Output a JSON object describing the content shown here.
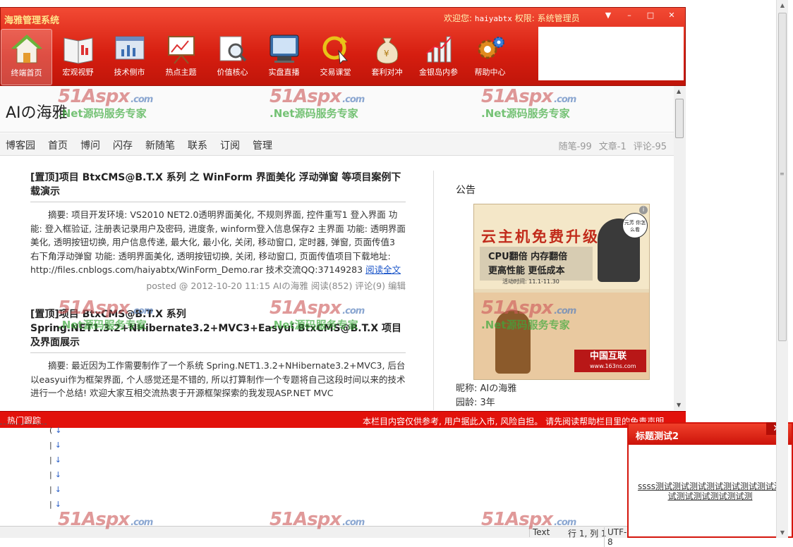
{
  "app": {
    "title": "海雅管理系统",
    "welcome_label": "欢迎您:",
    "username": "haiyabtx",
    "role_label": "权限:",
    "role": "系统管理员",
    "window_buttons": [
      "▼",
      "–",
      "□",
      "✕"
    ]
  },
  "nav": [
    {
      "label": "终端首页",
      "icon": "home-icon",
      "active": true
    },
    {
      "label": "宏观视野",
      "icon": "book-icon"
    },
    {
      "label": "技术侧市",
      "icon": "chart-window-icon"
    },
    {
      "label": "热点主题",
      "icon": "presentation-board-icon"
    },
    {
      "label": "价值核心",
      "icon": "magnifier-icon"
    },
    {
      "label": "实盘直播",
      "icon": "monitor-icon"
    },
    {
      "label": "交易课堂",
      "icon": "refresh-cursor-icon"
    },
    {
      "label": "套利对冲",
      "icon": "money-bag-icon"
    },
    {
      "label": "金银岛内参",
      "icon": "bar-chart-icon"
    },
    {
      "label": "帮助中心",
      "icon": "gear-icon"
    }
  ],
  "blog": {
    "title": "AIの海雅",
    "nav_links": [
      "博客园",
      "首页",
      "博问",
      "闪存",
      "新随笔",
      "联系",
      "订阅",
      "管理"
    ],
    "stats": [
      "随笔-99",
      "文章-1",
      "评论-95"
    ]
  },
  "posts": [
    {
      "title": "[置顶]项目 BtxCMS@B.T.X 系列 之 WinForm 界面美化 浮动弹窗 等项目案例下载演示",
      "summary": "摘要: 项目开发环境: VS2010 NET2.0透明界面美化, 不规则界面, 控件重写1 登入界面 功能: 登入框验证, 注册表记录用户及密码, 进度条, winform登入信息保存2 主界面 功能: 透明界面美化, 透明按钮切换, 用户信息传递, 最大化, 最小化, 关闭, 移动窗口, 定时器, 弹窗, 页面传值3 右下角浮动弹窗 功能: 透明界面美化, 透明按钮切换, 关闭, 移动窗口, 页面传值项目下载地址: http://files.cnblogs.com/haiyabtx/WinForm_Demo.rar 技术交流QQ:37149283",
      "read_more": "阅读全文",
      "meta": "posted @ 2012-10-20 11:15 AIの海雅 阅读(852) 评论(9) 编辑"
    },
    {
      "title": "[置顶]项目 BtxCMS@B.T.X 系列 Spring.NET1.3.2+NHibernate3.2+MVC3+Easyui BtxCMS@B.T.X 项目及界面展示",
      "summary": "摘要: 最近因为工作需要制作了一个系统 Spring.NET1.3.2+NHibernate3.2+MVC3, 后台以easyui作为框架界面, 个人感觉还是不错的, 所以打算制作一个专题将自己这段时间以来的技术进行一个总结! 欢迎大家互相交流热衷于开源框架探索的我发现ASP.NET MVC"
    }
  ],
  "sidebar": {
    "heading": "公告",
    "ad": {
      "headline": "云主机免费升级",
      "lines": [
        "CPU翻倍  内存翻倍",
        "更高性能  更低成本"
      ],
      "date": "活动时间: 11.1-11.30",
      "bubble": "元芳 你怎么看",
      "brand": "中国互联",
      "brand_url": "www.163ns.com",
      "info": "i"
    },
    "nickname": "昵称: AIの海雅",
    "age": "园龄: 3年"
  },
  "watermark": {
    "logo": "51Aspx",
    "suffix": ".com",
    "tagline": ".Net源码服务专家"
  },
  "tracker": {
    "title": "热门跟踪",
    "notice": "本栏目内容仅供参考, 用户据此入市, 风险自担。 请先阅读帮助栏目里的免责声明。"
  },
  "editor": {
    "line_marker": "↓"
  },
  "statusbar": {
    "mode": "Text",
    "position": "行 1, 列 1",
    "encoding": "UTF-8"
  },
  "popup": {
    "title": "标题测试2",
    "close": "✕",
    "message": "ssss测试测试测试测试测试测试测试测试测试测试测试测试测"
  },
  "colors": {
    "accent": "#d61e10",
    "link": "#1a55c9",
    "watermark_green": "#3caa3c"
  }
}
